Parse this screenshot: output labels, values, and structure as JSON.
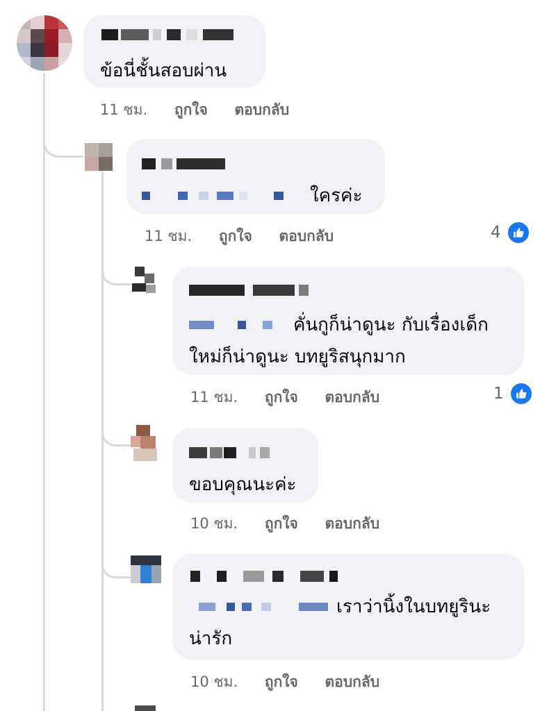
{
  "comments": [
    {
      "text_lines": [
        "ข้อนี่ชั้นสอบผ่าน"
      ],
      "time": "11 ชม.",
      "like_label": "ถูกใจ",
      "reply_label": "ตอบกลับ"
    },
    {
      "text_lines": [
        "ใครค่ะ"
      ],
      "time": "11 ชม.",
      "like_label": "ถูกใจ",
      "reply_label": "ตอบกลับ",
      "reaction_count": "4"
    },
    {
      "text_lines": [
        "คั่นกูก็น่าดูนะ กับเรื่องเด็ก",
        "ใหม่ก็น่าดูนะ  บทยูริสนุกมาก"
      ],
      "time": "11 ชม.",
      "like_label": "ถูกใจ",
      "reply_label": "ตอบกลับ",
      "reaction_count": "1"
    },
    {
      "text_lines": [
        "ขอบคุณนะค่ะ"
      ],
      "time": "10 ชม.",
      "like_label": "ถูกใจ",
      "reply_label": "ตอบกลับ"
    },
    {
      "text_lines": [
        "เราว่านิ้งในบทยูรินะ",
        "น่ารัก"
      ],
      "time": "10 ชม.",
      "like_label": "ถูกใจ",
      "reply_label": "ตอบกลับ"
    }
  ],
  "colors": {
    "like": "#1877f2",
    "bubble": "#f0f2f5",
    "meta": "#65676b",
    "mention": "#385898"
  },
  "icons": {
    "reaction": "thumbs-up-icon"
  }
}
